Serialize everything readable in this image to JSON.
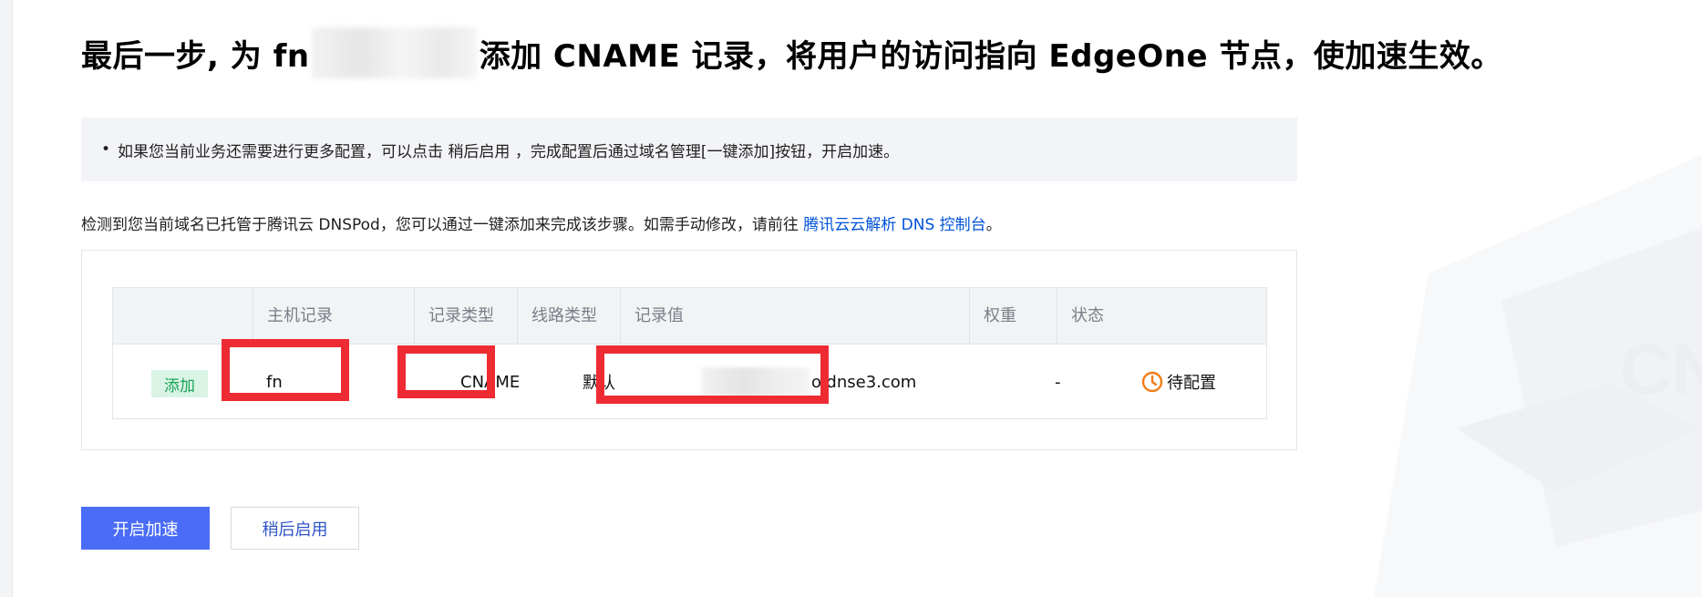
{
  "header": {
    "title_prefix": "最后一步, 为 fn",
    "title_suffix": "添加 CNAME 记录，将用户的访问指向 EdgeOne 节点，使加速生效。"
  },
  "tip": {
    "bullet": "•",
    "text": "如果您当前业务还需要进行更多配置，可以点击 稍后启用 ，完成配置后通过域名管理[一键添加]按钮，开启加速。"
  },
  "detect": {
    "text": "检测到您当前域名已托管于腾讯云 DNSPod，您可以通过一键添加来完成该步骤。如需手动修改，请前往 ",
    "link": "腾讯云云解析 DNS 控制台",
    "end": "。"
  },
  "table": {
    "columns": [
      "主机记录",
      "记录类型",
      "线路类型",
      "记录值",
      "权重",
      "状态"
    ],
    "row": {
      "action": "添加",
      "host": "fn",
      "type": "CNAME",
      "line": "默认",
      "value_suffix": "o.dnse3.com",
      "weight": "-",
      "status": "待配置"
    }
  },
  "buttons": {
    "primary": "开启加速",
    "secondary": "稍后启用"
  },
  "decoration": {
    "watermark": "CNA"
  },
  "colors": {
    "accent": "#4a6cf7",
    "link": "#0052d9",
    "highlight_red": "#ee2b33",
    "badge_green_bg": "#d9f4e4",
    "badge_green_text": "#1aa35a",
    "status_orange": "#f27c16"
  },
  "icons": {
    "status": "clock-icon"
  }
}
